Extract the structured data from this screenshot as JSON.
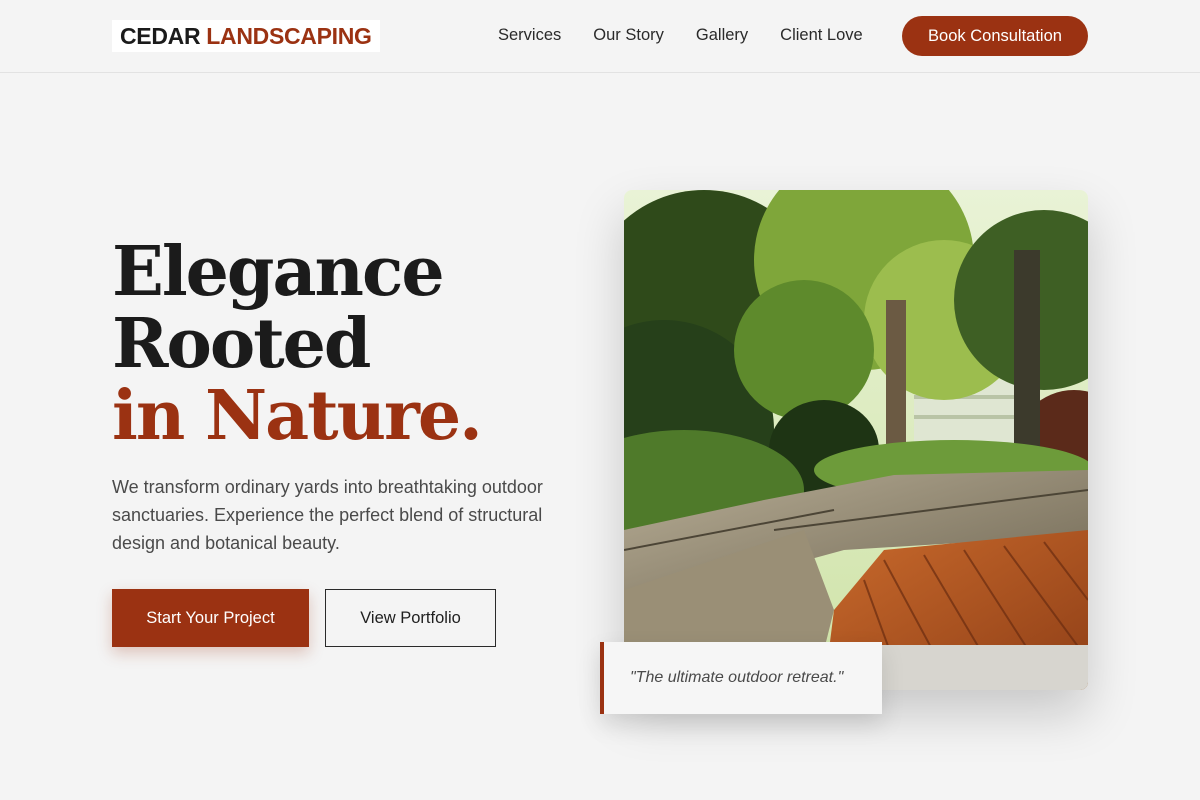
{
  "header": {
    "logo_main": "CEDAR",
    "logo_accent": "LANDSCAPING",
    "nav": [
      "Services",
      "Our Story",
      "Gallery",
      "Client Love"
    ],
    "cta": "Book Consultation"
  },
  "hero": {
    "title_line1": "Elegance",
    "title_line2": "Rooted",
    "title_line3": "in Nature.",
    "description": "We transform ordinary yards into breathtaking outdoor sanctuaries. Experience the perfect blend of structural design and botanical beauty.",
    "primary_button": "Start Your Project",
    "secondary_button": "View Portfolio",
    "quote": "\"The ultimate outdoor retreat.\""
  },
  "colors": {
    "accent": "#9b3212",
    "background": "#f4f4f4",
    "text": "#1b1b1b"
  }
}
